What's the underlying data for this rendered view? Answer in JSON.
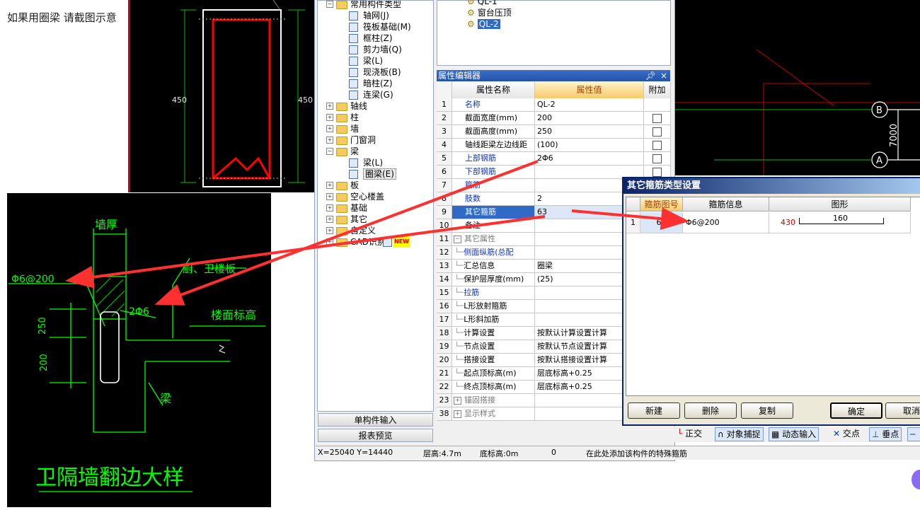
{
  "caption": "如果用圈梁 请截图示意",
  "cad_top": {
    "dim_left": "450",
    "dim_right": "450"
  },
  "cad_detail": {
    "wall_thick": "墙厚",
    "stirrup": "Φ6@200",
    "room": "厨、卫楼板",
    "bars": "2Φ6",
    "floor_level": "楼面标高",
    "dim_250": "250",
    "dim_200": "200",
    "beam": "梁",
    "title": "卫隔墙翻边大样"
  },
  "cad_right": {
    "axis_b": "B",
    "axis_a": "A",
    "dim_7000": "7000"
  },
  "tree": {
    "items": [
      {
        "label": "常用构件类型",
        "lvl": 1,
        "pm": "−",
        "kind": "folder"
      },
      {
        "label": "轴网(J)",
        "lvl": 2,
        "kind": "icon"
      },
      {
        "label": "筏板基础(M)",
        "lvl": 2,
        "kind": "icon"
      },
      {
        "label": "框柱(Z)",
        "lvl": 2,
        "kind": "icon"
      },
      {
        "label": "剪力墙(Q)",
        "lvl": 2,
        "kind": "icon"
      },
      {
        "label": "梁(L)",
        "lvl": 2,
        "kind": "icon"
      },
      {
        "label": "现浇板(B)",
        "lvl": 2,
        "kind": "icon"
      },
      {
        "label": "暗柱(Z)",
        "lvl": 2,
        "kind": "icon"
      },
      {
        "label": "连梁(G)",
        "lvl": 2,
        "kind": "icon"
      },
      {
        "label": "轴线",
        "lvl": 1,
        "pm": "+",
        "kind": "folder"
      },
      {
        "label": "柱",
        "lvl": 1,
        "pm": "+",
        "kind": "folder"
      },
      {
        "label": "墙",
        "lvl": 1,
        "pm": "+",
        "kind": "folder"
      },
      {
        "label": "门窗洞",
        "lvl": 1,
        "pm": "+",
        "kind": "folder"
      },
      {
        "label": "梁",
        "lvl": 1,
        "pm": "−",
        "kind": "folder"
      },
      {
        "label": "梁(L)",
        "lvl": 2,
        "kind": "icon"
      },
      {
        "label": "圈梁(E)",
        "lvl": 2,
        "kind": "icon",
        "selected": true
      },
      {
        "label": "板",
        "lvl": 1,
        "pm": "+",
        "kind": "folder"
      },
      {
        "label": "空心楼盖",
        "lvl": 1,
        "pm": "+",
        "kind": "folder"
      },
      {
        "label": "基础",
        "lvl": 1,
        "pm": "+",
        "kind": "folder"
      },
      {
        "label": "其它",
        "lvl": 1,
        "pm": "+",
        "kind": "folder"
      },
      {
        "label": "自定义",
        "lvl": 1,
        "pm": "+",
        "kind": "folder"
      },
      {
        "label": "CAD识别",
        "lvl": 1,
        "pm": "+",
        "kind": "folder",
        "new": "NEW"
      }
    ],
    "btn_single": "单构件输入",
    "btn_report": "报表预览"
  },
  "top_list": [
    {
      "label": "QL-1"
    },
    {
      "label": "窗台压顶"
    },
    {
      "label": "QL-2",
      "selected": true
    }
  ],
  "prop_editor": {
    "title": "属性编辑器",
    "pin": "ꟷ",
    "close": "×",
    "headers": [
      "属性名称",
      "属性值",
      "附加"
    ],
    "rows": [
      {
        "n": "1",
        "name": "名称",
        "value": "QL-2",
        "blue": true,
        "chk": false
      },
      {
        "n": "2",
        "name": "截面宽度(mm)",
        "value": "200",
        "chk": true
      },
      {
        "n": "3",
        "name": "截面高度(mm)",
        "value": "250",
        "chk": true
      },
      {
        "n": "4",
        "name": "轴线距梁左边线距",
        "value": "(100)",
        "chk": true
      },
      {
        "n": "5",
        "name": "上部钢筋",
        "value": "2Φ6",
        "blue": true,
        "chk": true
      },
      {
        "n": "6",
        "name": "下部钢筋",
        "value": "",
        "blue": true,
        "chk": true
      },
      {
        "n": "7",
        "name": "箍筋",
        "value": "",
        "blue": true,
        "chk": false
      },
      {
        "n": "8",
        "name": "肢数",
        "value": "2",
        "blue": true,
        "chk": false
      },
      {
        "n": "9",
        "name": "其它箍筋",
        "value": "63",
        "selected": true,
        "chk": false
      },
      {
        "n": "10",
        "name": "备注",
        "value": "",
        "chk": false
      },
      {
        "n": "11",
        "name": "其它属性",
        "value": "",
        "group": "−",
        "chk": false
      },
      {
        "n": "12",
        "name": "侧面纵筋(总配",
        "value": "",
        "blue": true,
        "indent": true,
        "chk": false
      },
      {
        "n": "13",
        "name": "汇总信息",
        "value": "圈梁",
        "indent": true,
        "chk": false
      },
      {
        "n": "14",
        "name": "保护层厚度(mm)",
        "value": "(25)",
        "indent": true,
        "chk": false
      },
      {
        "n": "15",
        "name": "拉筋",
        "value": "",
        "blue": true,
        "indent": true,
        "chk": false
      },
      {
        "n": "16",
        "name": "L形放射箍筋",
        "value": "",
        "indent": true,
        "chk": false
      },
      {
        "n": "17",
        "name": "L形斜加筋",
        "value": "",
        "indent": true,
        "chk": false
      },
      {
        "n": "18",
        "name": "计算设置",
        "value": "按默认计算设置计算",
        "indent": true,
        "chk": false
      },
      {
        "n": "19",
        "name": "节点设置",
        "value": "按默认节点设置计算",
        "indent": true,
        "chk": false
      },
      {
        "n": "20",
        "name": "搭接设置",
        "value": "按默认搭接设置计算",
        "indent": true,
        "chk": false
      },
      {
        "n": "21",
        "name": "起点顶标高(m)",
        "value": "层底标高+0.25",
        "indent": true,
        "chk": false
      },
      {
        "n": "22",
        "name": "终点顶标高(m)",
        "value": "层底标高+0.25",
        "indent": true,
        "chk": false
      },
      {
        "n": "23",
        "name": "锚固搭接",
        "value": "",
        "group": "+",
        "chk": false
      },
      {
        "n": "38",
        "name": "显示样式",
        "value": "",
        "group": "+",
        "chk": false
      }
    ]
  },
  "status": {
    "coords": "X=25040 Y=14440",
    "floor_h": "层高:4.7m",
    "base_h": "底标高:0m",
    "zero": "0",
    "hint": "在此处添加该构件的特殊箍筋"
  },
  "snap": {
    "ortho": "正交",
    "osnap": "对象捕捉",
    "dyn": "动态输入",
    "inter": "交点",
    "perp": "垂点"
  },
  "dialog": {
    "title": "其它箍筋类型设置",
    "headers": [
      "箍筋图号",
      "箍筋信息",
      "图形"
    ],
    "row": {
      "n": "1",
      "code": "63",
      "info": "Φ6@200",
      "dim_a": "430",
      "dim_b": "160"
    },
    "btn_new": "新建",
    "btn_delete": "删除",
    "btn_copy": "复制",
    "btn_ok": "确定",
    "btn_cancel": "取消"
  },
  "colors": {
    "accent": "#2453a8",
    "selected": "#3169c6",
    "annotation_arrow": "#ff3030",
    "cad_green": "#00ff00"
  }
}
